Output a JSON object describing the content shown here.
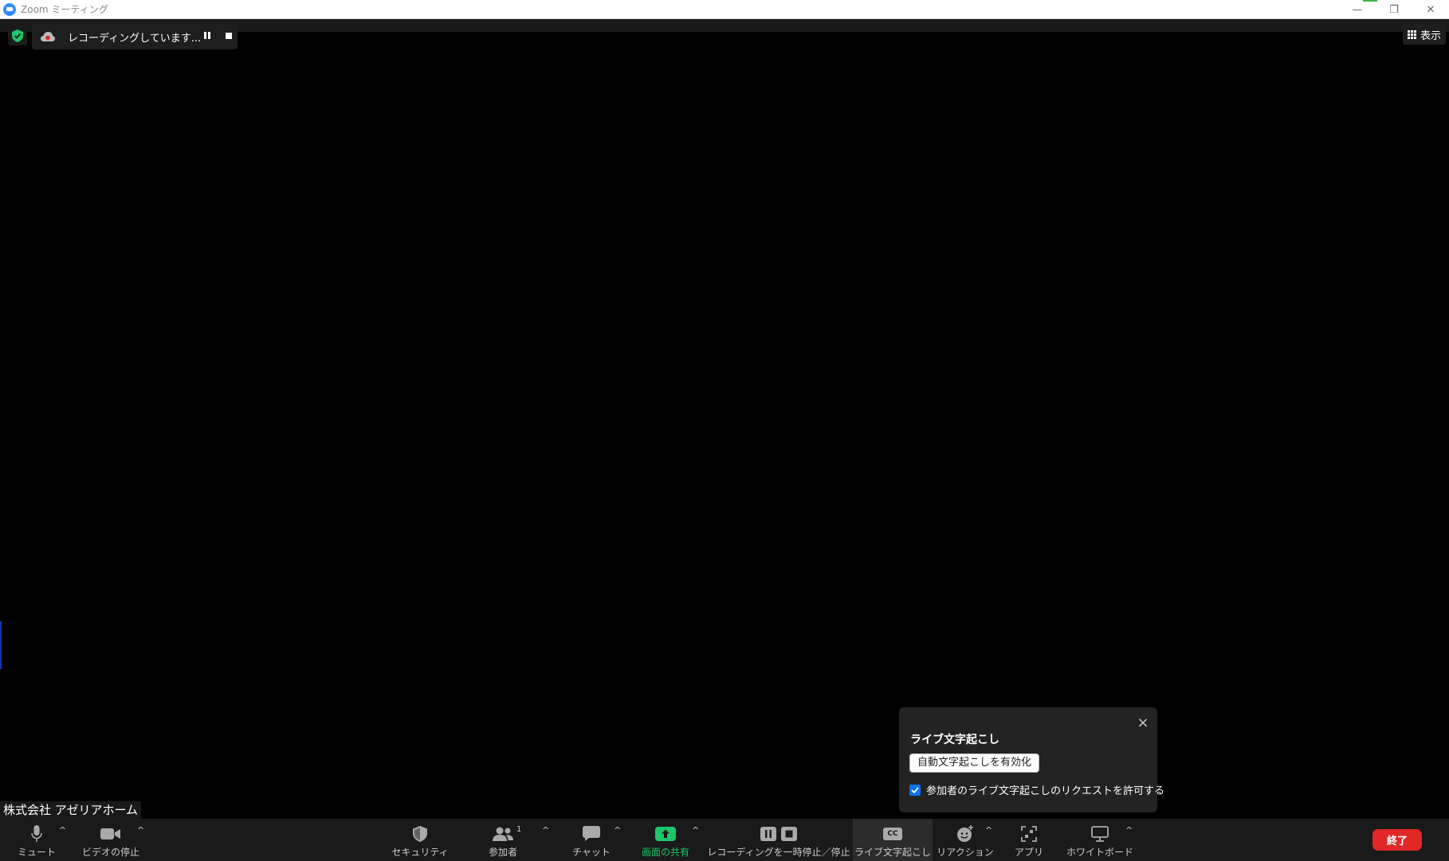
{
  "window": {
    "title": "Zoom ミーティング",
    "controls": {
      "minimize": "—",
      "restore": "❐",
      "close": "✕"
    }
  },
  "recording": {
    "status_text": "レコーディングしています..."
  },
  "view": {
    "label": "表示"
  },
  "participant": {
    "name": "株式会社 アゼリアホーム"
  },
  "caption_popup": {
    "title": "ライブ文字起こし",
    "enable_button": "自動文字起こしを有効化",
    "checkbox_label": "参加者のライブ文字起こしのリクエストを許可する",
    "checkbox_checked": true,
    "close": "×"
  },
  "toolbar": {
    "mute": "ミュート",
    "video": "ビデオの停止",
    "security": "セキュリティ",
    "participants": "参加者",
    "participants_count": "1",
    "chat": "チャット",
    "share": "画面の共有",
    "recording_control": "レコーディングを一時停止／停止",
    "captions": "ライブ文字起こし",
    "captions_icon_text": "CC",
    "reactions": "リアクション",
    "apps": "アプリ",
    "whiteboard": "ホワイトボード",
    "caret": "^",
    "end": "終了"
  },
  "colors": {
    "share_green": "#1ec66b",
    "end_red": "#e02828",
    "checkbox_blue": "#0e72ed",
    "security_green": "#1ec66b"
  }
}
